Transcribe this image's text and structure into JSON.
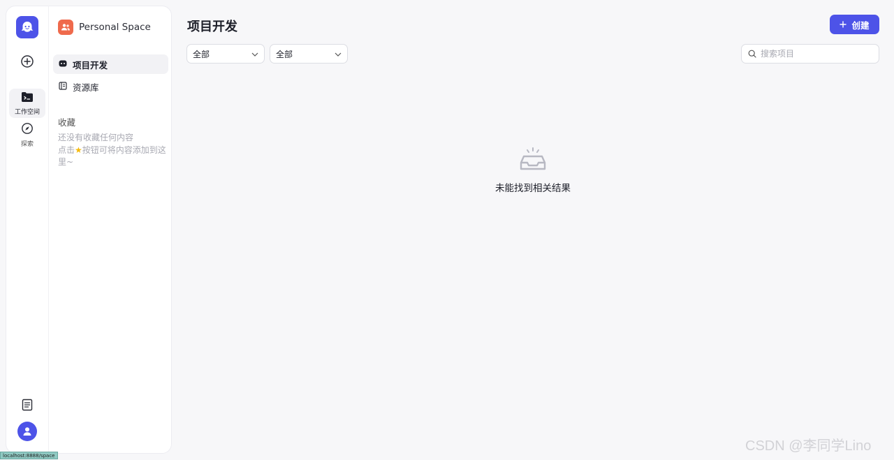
{
  "rail": {
    "items": [
      {
        "label": "工作空间",
        "icon": "workspace-terminal-icon",
        "active": true
      },
      {
        "label": "探索",
        "icon": "compass-icon",
        "active": false
      }
    ]
  },
  "sidebar": {
    "space_name": "Personal Space",
    "nav": [
      {
        "label": "项目开发",
        "icon": "bot-icon",
        "active": true
      },
      {
        "label": "资源库",
        "icon": "library-icon",
        "active": false
      }
    ],
    "favorites_title": "收藏",
    "favorites_empty_line1": "还没有收藏任何内容",
    "favorites_empty_line2_before": "点击",
    "favorites_empty_line2_after": "按钮可将内容添加到这里~"
  },
  "main": {
    "title": "项目开发",
    "create_label": "创建",
    "filter1": "全部",
    "filter2": "全部",
    "search_placeholder": "搜索项目",
    "empty_text": "未能找到相关结果"
  },
  "watermark": "CSDN @李同学Lino",
  "statusbar": "localhost:8888/space",
  "colors": {
    "accent": "#4d53e8",
    "space_avatar": "#ef6a4c"
  }
}
